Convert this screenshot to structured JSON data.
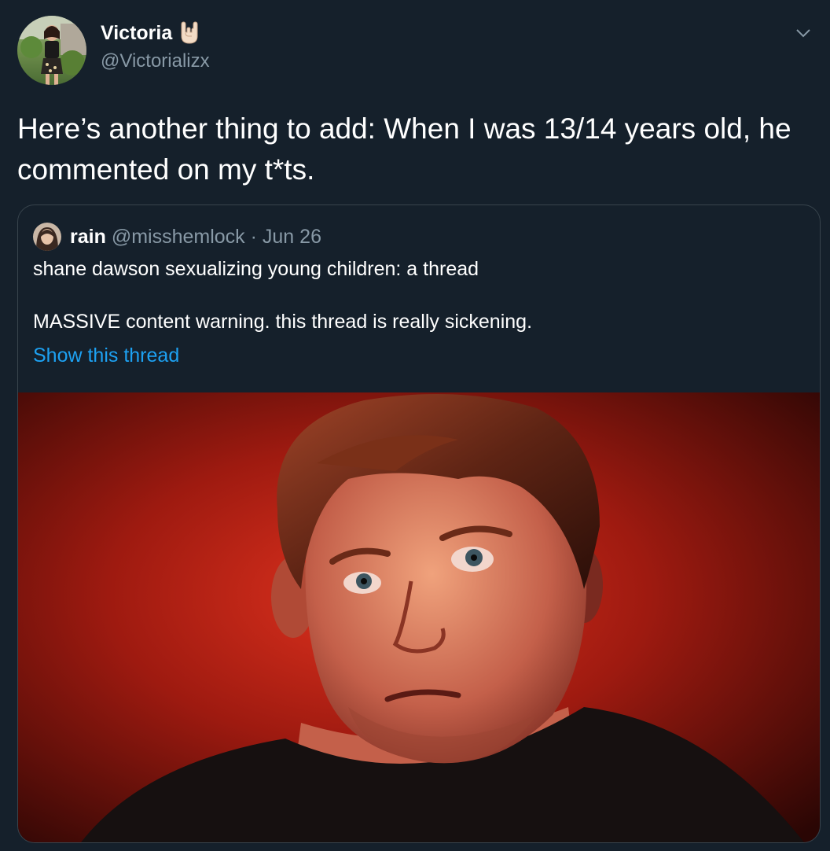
{
  "tweet": {
    "author_name": "Victoria",
    "name_emoji": "sign-of-the-horns-icon",
    "handle": "@Victorializx",
    "text": "Here’s another thing to add: When I was 13/14 years old, he commented on my t*ts."
  },
  "quoted_tweet": {
    "name": "rain",
    "handle": "@misshemlock",
    "separator": "·",
    "date": "Jun 26",
    "line1": "shane dawson sexualizing young children: a thread",
    "line2": "MASSIVE content warning. this thread is really sickening.",
    "show_thread": "Show this thread",
    "media": "photo-of-man-red-lighting"
  },
  "colors": {
    "background": "#15202b",
    "text_primary": "#ffffff",
    "text_secondary": "#8899a6",
    "link": "#1da1f2",
    "border": "#38444d"
  },
  "icons": {
    "menu": "chevron-down-icon"
  }
}
